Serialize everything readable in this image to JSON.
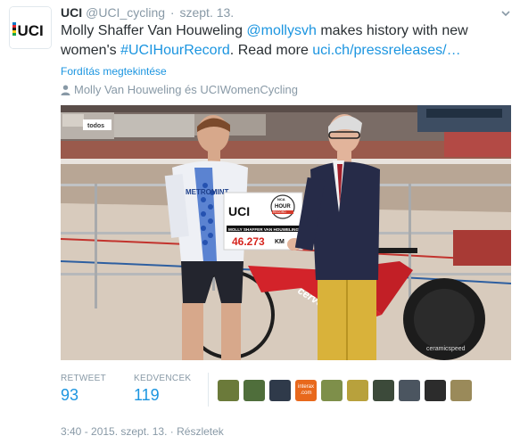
{
  "tweet": {
    "fullname": "UCI",
    "username": "@UCI_cycling",
    "separator": "·",
    "date": "szept. 13.",
    "text_line1_plain": "Molly Shaffer Van Houweling ",
    "mention": "@mollysvh",
    "text_line1_rest": " makes history with new",
    "text_line2_plain": "women's ",
    "hashtag": "#UCIHourRecord",
    "text_line2_mid": ". Read more ",
    "link": "uci.ch/pressreleases/…",
    "translate_label": "Fordítás megtekintése",
    "tagged_people": "Molly Van Houweling és UCIWomenCycling"
  },
  "photo": {
    "sign_logo": "UCI",
    "sign_badge_small": "NCA",
    "sign_badge": "HOUR",
    "sign_badge_sub": "RECORD",
    "sign_name": "MOLLY SHAFFER VAN HOUWELING",
    "sign_distance": "46.273",
    "sign_unit": "KM",
    "jersey_text": "METROMINT",
    "banner_text": "todos",
    "bike_brand": "cervelo"
  },
  "stats": {
    "retweet_label": "RETWEET",
    "retweet_count": "93",
    "favorites_label": "KEDVENCEK",
    "favorites_count": "119"
  },
  "favorite_avatars": [
    {
      "name": "favoriter-avatar-1",
      "color": "#6b7a3a"
    },
    {
      "name": "favoriter-avatar-2",
      "color": "#4f6e3b"
    },
    {
      "name": "favoriter-avatar-3",
      "color": "#2f3a4a"
    },
    {
      "name": "favoriter-avatar-4",
      "color": "#e8681c",
      "text": "interax\n.com"
    },
    {
      "name": "favoriter-avatar-5",
      "color": "#7e8f4a"
    },
    {
      "name": "favoriter-avatar-6",
      "color": "#b8a13c"
    },
    {
      "name": "favoriter-avatar-7",
      "color": "#3c4a3a"
    },
    {
      "name": "favoriter-avatar-8",
      "color": "#4b5560"
    },
    {
      "name": "favoriter-avatar-9",
      "color": "#2c2c2c"
    },
    {
      "name": "favoriter-avatar-10",
      "color": "#9a8a5a"
    }
  ],
  "footer": {
    "time": "3:40 - 2015. szept. 13.",
    "separator": "·",
    "details": "Részletek"
  },
  "colors": {
    "link": "#1b95e0",
    "muted": "#8899a6",
    "text": "#292f33"
  }
}
